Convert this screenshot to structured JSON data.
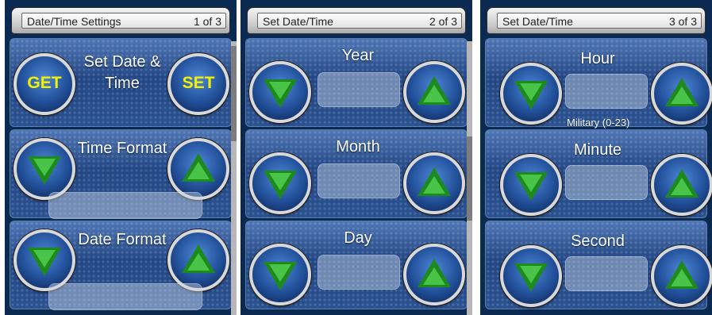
{
  "panels": [
    {
      "header_title": "Date/Time Settings",
      "header_page": "1 of 3",
      "sections": [
        {
          "label": "Set Date & Time",
          "left_button": "GET",
          "right_button": "SET"
        },
        {
          "label": "Time Format",
          "left_button_icon": "down-arrow-icon",
          "right_button_icon": "up-arrow-icon",
          "value": ""
        },
        {
          "label": "Date Format",
          "left_button_icon": "down-arrow-icon",
          "right_button_icon": "up-arrow-icon",
          "value": ""
        }
      ],
      "scroll_position_fraction": 0.0
    },
    {
      "header_title": "Set Date/Time",
      "header_page": "2 of 3",
      "sections": [
        {
          "label": "Year",
          "value": ""
        },
        {
          "label": "Month",
          "value": ""
        },
        {
          "label": "Day",
          "value": ""
        }
      ],
      "scroll_position_fraction": 0.5
    },
    {
      "header_title": "Set Date/Time",
      "header_page": "3 of 3",
      "sections": [
        {
          "label": "Hour",
          "value": "",
          "hint": "Military (0-23)"
        },
        {
          "label": "Minute",
          "value": ""
        },
        {
          "label": "Second",
          "value": ""
        }
      ]
    }
  ],
  "colors": {
    "button_text": "#f2f200",
    "arrow_green": "#49c449",
    "panel_blue": "#2e5592"
  }
}
